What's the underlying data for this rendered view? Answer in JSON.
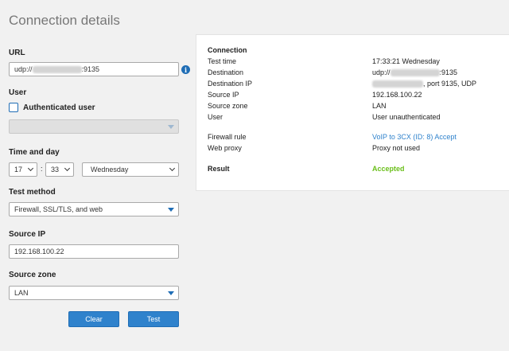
{
  "page_title": "Connection details",
  "form": {
    "url_label": "URL",
    "url_prefix": "udp://",
    "url_suffix": ":9135",
    "user_label": "User",
    "authenticated_user_label": "Authenticated user",
    "auth_checked": false,
    "time_label": "Time and day",
    "hour": "17",
    "time_separator": ":",
    "minute": "33",
    "day": "Wednesday",
    "test_method_label": "Test method",
    "test_method": "Firewall, SSL/TLS, and web",
    "source_ip_label": "Source IP",
    "source_ip": "192.168.100.22",
    "source_zone_label": "Source zone",
    "source_zone": "LAN",
    "clear_label": "Clear",
    "test_label": "Test"
  },
  "result_panel": {
    "heading": "Connection",
    "rows": [
      {
        "key": "Test time",
        "value": "17:33:21 Wednesday"
      },
      {
        "key": "Destination",
        "value_prefix": "udp://",
        "value_suffix": ":9135"
      },
      {
        "key": "Destination IP",
        "value_suffix": ", port 9135, UDP"
      },
      {
        "key": "Source IP",
        "value": "192.168.100.22"
      },
      {
        "key": "Source zone",
        "value": "LAN"
      },
      {
        "key": "User",
        "value": "User unauthenticated"
      }
    ],
    "firewall_rule_label": "Firewall rule",
    "firewall_rule_value": "VoIP to 3CX (ID: 8) Accept",
    "web_proxy_label": "Web proxy",
    "web_proxy_value": "Proxy not used",
    "result_label": "Result",
    "result_value": "Accepted"
  },
  "colors": {
    "accent": "#2f82cc",
    "success": "#6abf1a",
    "background": "#f1f1f1"
  },
  "icons": {
    "info": "info-icon",
    "checkbox": "checkbox-unchecked-icon"
  }
}
